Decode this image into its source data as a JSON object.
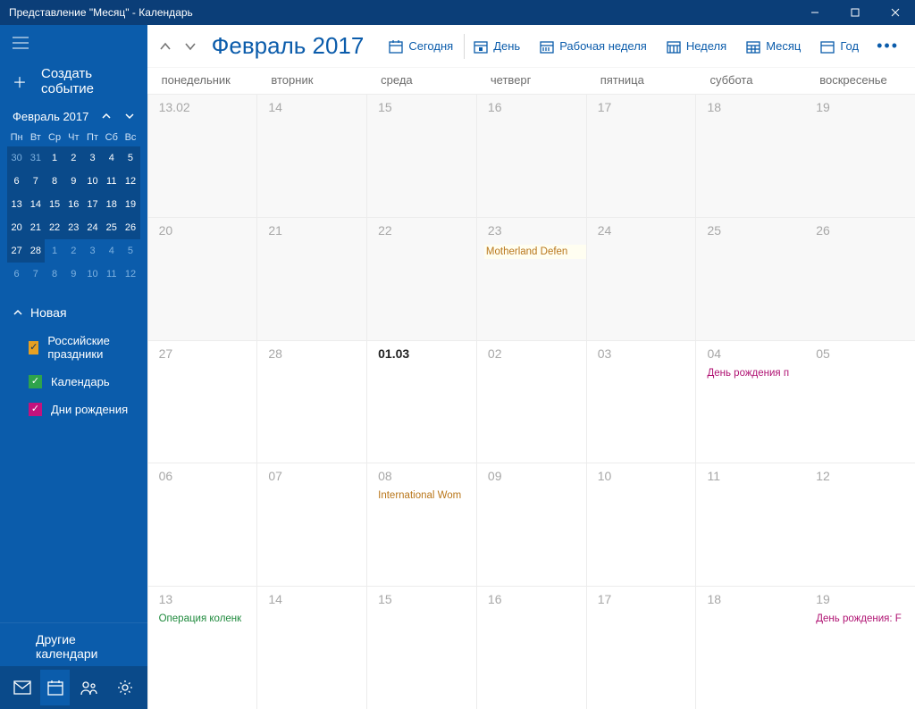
{
  "window": {
    "title": "Представление \"Месяц\" - Календарь"
  },
  "sidebar": {
    "newEvent": "Создать событие",
    "miniTitle": "Февраль 2017",
    "dow": [
      "Пн",
      "Вт",
      "Ср",
      "Чт",
      "Пт",
      "Сб",
      "Вс"
    ],
    "mini": [
      {
        "n": "30",
        "dim": true,
        "cur": true
      },
      {
        "n": "31",
        "dim": true,
        "cur": true
      },
      {
        "n": "1",
        "cur": true
      },
      {
        "n": "2",
        "cur": true
      },
      {
        "n": "3",
        "cur": true
      },
      {
        "n": "4",
        "cur": true
      },
      {
        "n": "5",
        "cur": true
      },
      {
        "n": "6",
        "cur": true
      },
      {
        "n": "7",
        "cur": true
      },
      {
        "n": "8",
        "cur": true
      },
      {
        "n": "9",
        "cur": true
      },
      {
        "n": "10",
        "cur": true
      },
      {
        "n": "11",
        "cur": true
      },
      {
        "n": "12",
        "cur": true
      },
      {
        "n": "13",
        "cur": true
      },
      {
        "n": "14",
        "cur": true
      },
      {
        "n": "15",
        "cur": true
      },
      {
        "n": "16",
        "cur": true
      },
      {
        "n": "17",
        "cur": true
      },
      {
        "n": "18",
        "cur": true
      },
      {
        "n": "19",
        "cur": true
      },
      {
        "n": "20",
        "cur": true
      },
      {
        "n": "21",
        "cur": true
      },
      {
        "n": "22",
        "cur": true
      },
      {
        "n": "23",
        "cur": true
      },
      {
        "n": "24",
        "cur": true
      },
      {
        "n": "25",
        "cur": true
      },
      {
        "n": "26",
        "cur": true
      },
      {
        "n": "27",
        "cur": true
      },
      {
        "n": "28",
        "cur": true
      },
      {
        "n": "1",
        "dim": true
      },
      {
        "n": "2",
        "dim": true
      },
      {
        "n": "3",
        "dim": true
      },
      {
        "n": "4",
        "dim": true
      },
      {
        "n": "5",
        "dim": true
      },
      {
        "n": "6",
        "dim": true
      },
      {
        "n": "7",
        "dim": true
      },
      {
        "n": "8",
        "dim": true
      },
      {
        "n": "9",
        "dim": true
      },
      {
        "n": "10",
        "dim": true
      },
      {
        "n": "11",
        "dim": true
      },
      {
        "n": "12",
        "dim": true
      }
    ],
    "sectionTitle": "Новая",
    "calendars": [
      {
        "label": "Российские праздники",
        "color": "orange"
      },
      {
        "label": "Календарь",
        "color": "green"
      },
      {
        "label": "Дни рождения",
        "color": "magenta"
      }
    ],
    "otherCalendars": "Другие календари"
  },
  "header": {
    "monthTitle": "Февраль 2017",
    "today": "Сегодня",
    "day": "День",
    "workweek": "Рабочая неделя",
    "week": "Неделя",
    "month": "Месяц",
    "year": "Год"
  },
  "dow": [
    "понедельник",
    "вторник",
    "среда",
    "четверг",
    "пятница",
    "суббота",
    "воскресенье"
  ],
  "days": [
    {
      "n": "13.02",
      "dim": true
    },
    {
      "n": "14",
      "dim": true
    },
    {
      "n": "15",
      "dim": true
    },
    {
      "n": "16",
      "dim": true
    },
    {
      "n": "17",
      "dim": true
    },
    {
      "n": "18",
      "dim": true
    },
    {
      "n": "19",
      "dim": true
    },
    {
      "n": "20",
      "dim": true
    },
    {
      "n": "21",
      "dim": true
    },
    {
      "n": "22",
      "dim": true
    },
    {
      "n": "23",
      "dim": true,
      "events": [
        {
          "text": "Motherland Defen",
          "color": "orange",
          "hl": true
        }
      ]
    },
    {
      "n": "24",
      "dim": true
    },
    {
      "n": "25",
      "dim": true
    },
    {
      "n": "26",
      "dim": true
    },
    {
      "n": "27"
    },
    {
      "n": "28"
    },
    {
      "n": "01.03",
      "today": true
    },
    {
      "n": "02"
    },
    {
      "n": "03"
    },
    {
      "n": "04",
      "events": [
        {
          "text": "День рождения п",
          "color": "magenta"
        }
      ]
    },
    {
      "n": "05"
    },
    {
      "n": "06"
    },
    {
      "n": "07"
    },
    {
      "n": "08",
      "events": [
        {
          "text": "International Wom",
          "color": "orange"
        }
      ]
    },
    {
      "n": "09"
    },
    {
      "n": "10"
    },
    {
      "n": "11"
    },
    {
      "n": "12"
    },
    {
      "n": "13",
      "events": [
        {
          "text": "Операция коленк",
          "color": "green"
        }
      ]
    },
    {
      "n": "14"
    },
    {
      "n": "15"
    },
    {
      "n": "16"
    },
    {
      "n": "17"
    },
    {
      "n": "18"
    },
    {
      "n": "19",
      "events": [
        {
          "text": "День рождения: F",
          "color": "magenta"
        }
      ]
    }
  ]
}
